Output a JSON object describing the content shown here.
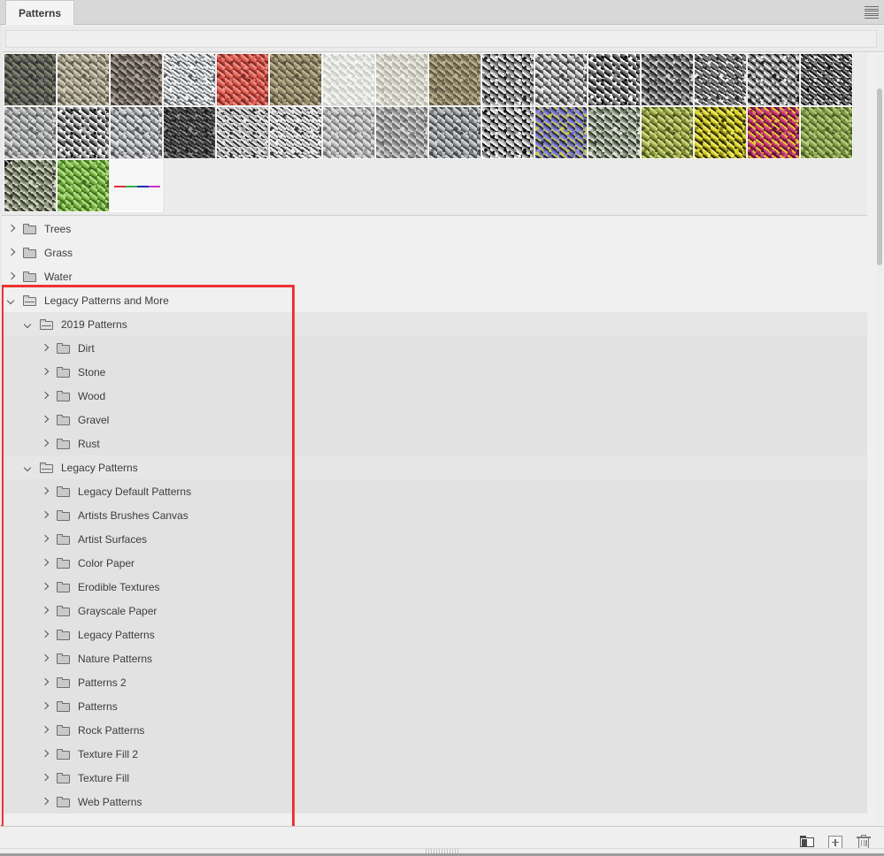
{
  "panel": {
    "tab_label": "Patterns",
    "menu_icon": "hamburger-menu-icon",
    "accent_highlight_color": "#ee3333"
  },
  "filter": {
    "value": "",
    "placeholder": ""
  },
  "swatches": {
    "rows": [
      [
        {
          "name": "dark-rock-texture",
          "colors": [
            "#4a4f4c",
            "#6b6b5e",
            "#2e3230",
            "#8c8574"
          ]
        },
        {
          "name": "pebbles-texture",
          "colors": [
            "#8f8a78",
            "#b5ae99",
            "#5c584a",
            "#d6d0bb"
          ]
        },
        {
          "name": "coarse-gravel-texture",
          "colors": [
            "#8a8077",
            "#5d5650",
            "#b3a99e",
            "#3a3633"
          ]
        },
        {
          "name": "white-speckle-granite-texture",
          "colors": [
            "#e8e9ea",
            "#9aa0a3",
            "#55595c",
            "#ffffff"
          ]
        },
        {
          "name": "red-rock-texture",
          "colors": [
            "#c0453c",
            "#e0675a",
            "#7d2a24",
            "#f0918a"
          ]
        },
        {
          "name": "olive-dirt-texture",
          "colors": [
            "#7d7358",
            "#a09270",
            "#55503e",
            "#c2b794"
          ]
        },
        {
          "name": "light-marble-texture",
          "colors": [
            "#eceeea",
            "#dadcd6",
            "#f6f7f4",
            "#c8cac4"
          ]
        },
        {
          "name": "pale-stone-texture",
          "colors": [
            "#dedcd2",
            "#c9c6ba",
            "#efeee8",
            "#b2afa4"
          ]
        },
        {
          "name": "sandy-grit-texture",
          "colors": [
            "#9c9376",
            "#7b7258",
            "#c0b694",
            "#5e5743"
          ]
        },
        {
          "name": "black-white-noise-texture",
          "colors": [
            "#1e1e1e",
            "#f2f2f2",
            "#6e6e6e",
            "#b4b4b4"
          ]
        },
        {
          "name": "gray-noise-texture",
          "colors": [
            "#787878",
            "#c8c8c8",
            "#3c3c3c",
            "#ededed"
          ]
        },
        {
          "name": "high-contrast-speckle-texture",
          "colors": [
            "#ffffff",
            "#101010",
            "#909090",
            "#585858"
          ]
        },
        {
          "name": "fine-gray-grain-texture",
          "colors": [
            "#8c8c8c",
            "#4f4f4f",
            "#d2d2d2",
            "#262626"
          ]
        },
        {
          "name": "dark-grain-texture",
          "colors": [
            "#2a2a2a",
            "#888888",
            "#efefef",
            "#5a5a5a"
          ]
        },
        {
          "name": "mottled-gray-texture",
          "colors": [
            "#6f6f6f",
            "#ededed",
            "#1c1c1c",
            "#a8a8a8"
          ]
        },
        {
          "name": "mixed-noise-texture",
          "colors": [
            "#414141",
            "#e5e5e5",
            "#7e7e7e",
            "#0e0e0e"
          ]
        }
      ],
      [
        {
          "name": "gray-stone-texture",
          "colors": [
            "#8d8f8e",
            "#b8bab9",
            "#5c5f5e",
            "#dcdedd"
          ]
        },
        {
          "name": "white-speckle-texture",
          "colors": [
            "#f4f4f4",
            "#1a1a1a",
            "#b9b9b9",
            "#6a6a6a"
          ]
        },
        {
          "name": "diagonal-fiber-texture",
          "colors": [
            "#8a8c8f",
            "#c3c5c8",
            "#4f5154",
            "#e2e3e5"
          ]
        },
        {
          "name": "dense-black-noise-texture",
          "colors": [
            "#1b1b1b",
            "#555555",
            "#8f8f8f",
            "#2e2e2e"
          ]
        },
        {
          "name": "salt-pepper-texture",
          "colors": [
            "#d8d8d8",
            "#2a2a2a",
            "#9b9b9b",
            "#f0f0f0"
          ]
        },
        {
          "name": "light-static-texture",
          "colors": [
            "#e6e6e6",
            "#a2a2a2",
            "#3b3b3b",
            "#fafafa"
          ]
        },
        {
          "name": "soft-gray-cloud-texture",
          "colors": [
            "#9f9f9f",
            "#c9c9c9",
            "#767676",
            "#e4e4e4"
          ]
        },
        {
          "name": "concrete-texture",
          "colors": [
            "#b4b4b4",
            "#8c8c8c",
            "#d8d8d8",
            "#666666"
          ]
        },
        {
          "name": "brushed-diagonal-texture",
          "colors": [
            "#777a7d",
            "#aeb1b4",
            "#44474a",
            "#d4d6d8"
          ]
        },
        {
          "name": "chunky-bw-texture",
          "colors": [
            "#111111",
            "#f5f5f5",
            "#7a7a7a",
            "#c0c0c0"
          ]
        },
        {
          "name": "purple-lichen-texture",
          "colors": [
            "#8f8fd8",
            "#6b6bb8",
            "#c9c95a",
            "#2a2a40"
          ]
        },
        {
          "name": "green-lichen-rock-texture",
          "colors": [
            "#a9b0a0",
            "#6d7a63",
            "#e0e4da",
            "#30382c"
          ]
        },
        {
          "name": "olive-leaves-texture",
          "colors": [
            "#7d8a32",
            "#a8b454",
            "#4a5320",
            "#d4dc8c"
          ]
        },
        {
          "name": "yellow-flowers-texture",
          "colors": [
            "#d9d32a",
            "#f0ea66",
            "#8a861a",
            "#2c2a08"
          ]
        },
        {
          "name": "magenta-flowers-texture",
          "colors": [
            "#a8275c",
            "#d44a84",
            "#5c1234",
            "#e8c832"
          ]
        },
        {
          "name": "green-moss-texture",
          "colors": [
            "#6f8a3a",
            "#93ad56",
            "#4a5e26",
            "#bccf84"
          ]
        }
      ],
      [
        {
          "name": "granite-lichen-texture",
          "selected": true,
          "colors": [
            "#9aa08a",
            "#6f7560",
            "#d2d6c6",
            "#33382a"
          ]
        },
        {
          "name": "grass-texture",
          "colors": [
            "#5f9a32",
            "#8cc45a",
            "#3d6b1e",
            "#b6e086"
          ]
        },
        {
          "name": "color-line-swatch",
          "is_line_swatch": true,
          "line_segments": [
            "#d83030",
            "#30b050",
            "#2030b0",
            "#d030c0"
          ]
        }
      ]
    ]
  },
  "tree": {
    "items": [
      {
        "label": "Trees",
        "depth": 0,
        "expanded": false,
        "shade": "none"
      },
      {
        "label": "Grass",
        "depth": 0,
        "expanded": false,
        "shade": "none"
      },
      {
        "label": "Water",
        "depth": 0,
        "expanded": false,
        "shade": "none"
      },
      {
        "label": "Legacy Patterns and More",
        "depth": 0,
        "expanded": true,
        "shade": "none"
      },
      {
        "label": "2019 Patterns",
        "depth": 1,
        "expanded": true,
        "shade": "one"
      },
      {
        "label": "Dirt",
        "depth": 2,
        "expanded": false,
        "shade": "two"
      },
      {
        "label": "Stone",
        "depth": 2,
        "expanded": false,
        "shade": "two"
      },
      {
        "label": "Wood",
        "depth": 2,
        "expanded": false,
        "shade": "two"
      },
      {
        "label": "Gravel",
        "depth": 2,
        "expanded": false,
        "shade": "two"
      },
      {
        "label": "Rust",
        "depth": 2,
        "expanded": false,
        "shade": "two"
      },
      {
        "label": "Legacy Patterns",
        "depth": 1,
        "expanded": true,
        "shade": "one"
      },
      {
        "label": "Legacy Default Patterns",
        "depth": 2,
        "expanded": false,
        "shade": "two"
      },
      {
        "label": "Artists Brushes Canvas",
        "depth": 2,
        "expanded": false,
        "shade": "two"
      },
      {
        "label": "Artist Surfaces",
        "depth": 2,
        "expanded": false,
        "shade": "two"
      },
      {
        "label": "Color Paper",
        "depth": 2,
        "expanded": false,
        "shade": "two"
      },
      {
        "label": "Erodible Textures",
        "depth": 2,
        "expanded": false,
        "shade": "two"
      },
      {
        "label": "Grayscale Paper",
        "depth": 2,
        "expanded": false,
        "shade": "two"
      },
      {
        "label": "Legacy Patterns",
        "depth": 2,
        "expanded": false,
        "shade": "two"
      },
      {
        "label": "Nature Patterns",
        "depth": 2,
        "expanded": false,
        "shade": "two"
      },
      {
        "label": "Patterns 2",
        "depth": 2,
        "expanded": false,
        "shade": "two"
      },
      {
        "label": "Patterns",
        "depth": 2,
        "expanded": false,
        "shade": "two"
      },
      {
        "label": "Rock Patterns",
        "depth": 2,
        "expanded": false,
        "shade": "two"
      },
      {
        "label": "Texture Fill 2",
        "depth": 2,
        "expanded": false,
        "shade": "two"
      },
      {
        "label": "Texture Fill",
        "depth": 2,
        "expanded": false,
        "shade": "two"
      },
      {
        "label": "Web Patterns",
        "depth": 2,
        "expanded": false,
        "shade": "two"
      }
    ]
  },
  "footer": {
    "buttons": [
      {
        "name": "new-folder-icon",
        "label": "New Group"
      },
      {
        "name": "new-pattern-icon",
        "label": "Create New Pattern"
      },
      {
        "name": "delete-icon",
        "label": "Delete"
      }
    ]
  }
}
